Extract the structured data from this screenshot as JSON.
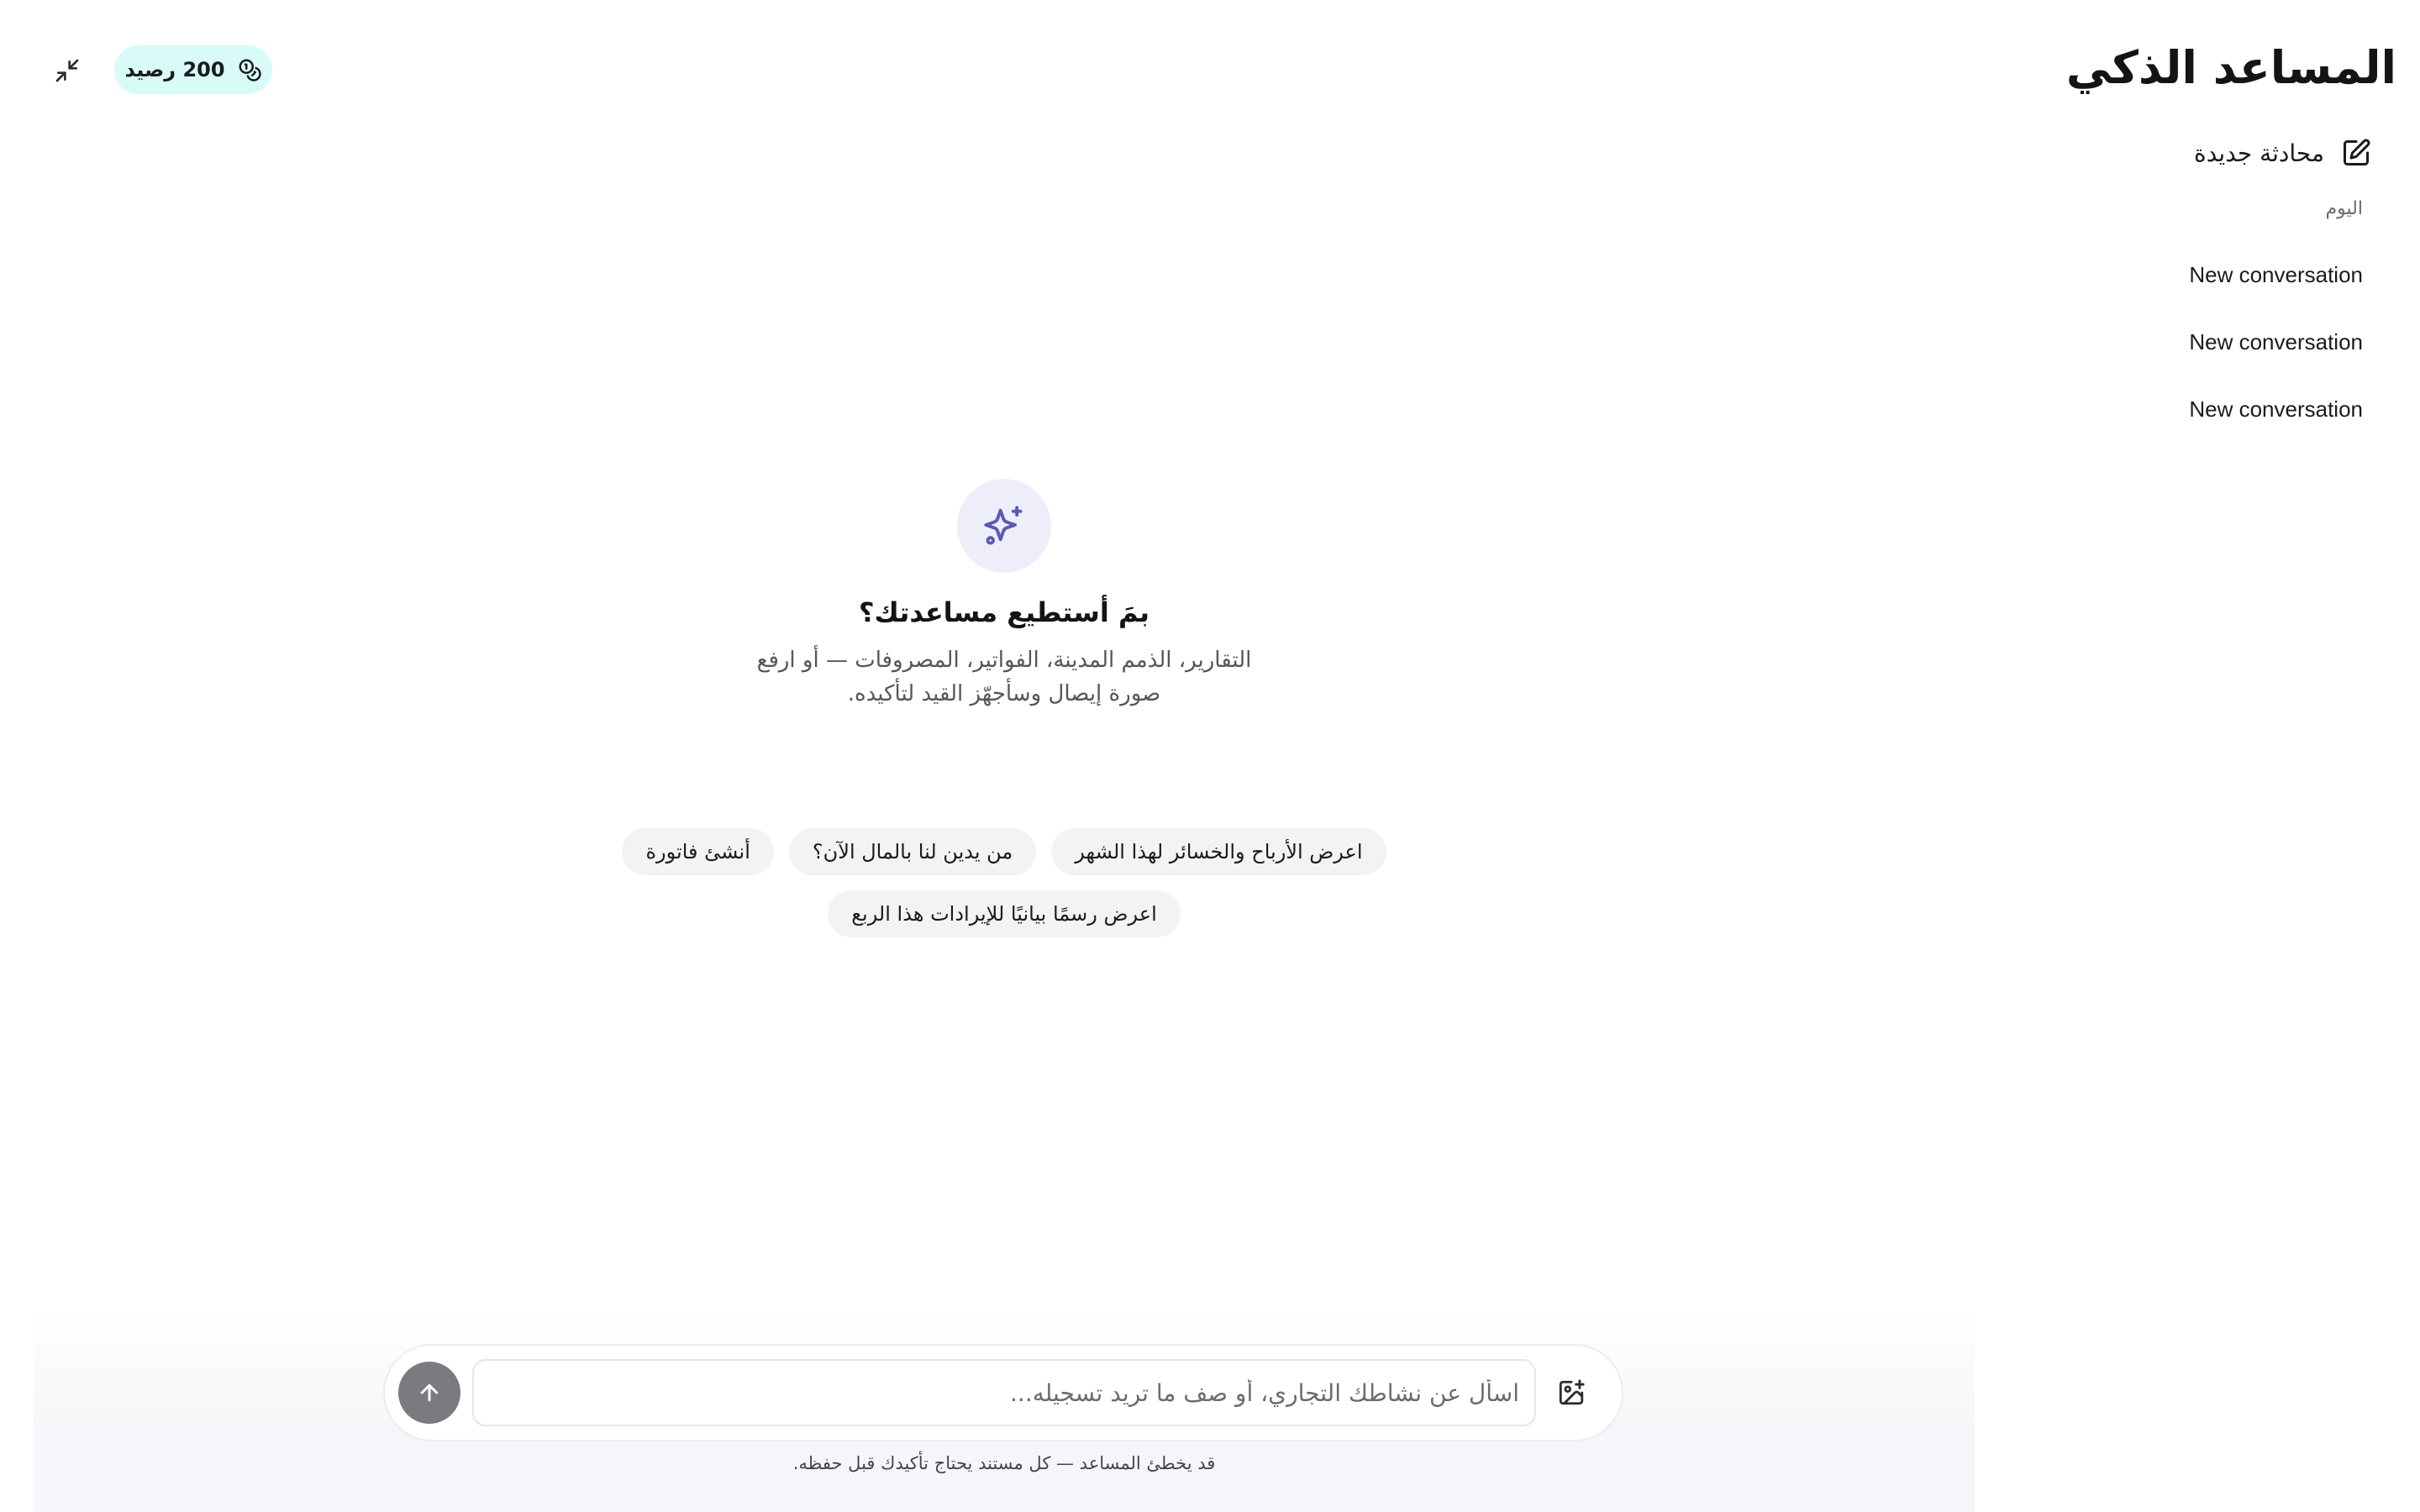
{
  "sidebar": {
    "title": "المساعد الذكي",
    "new_chat_label": "محادثة جديدة",
    "new_chat_icon": "edit-square-icon",
    "section_label": "اليوم",
    "conversations": [
      {
        "label": "New conversation"
      },
      {
        "label": "New conversation"
      },
      {
        "label": "New conversation"
      }
    ]
  },
  "header": {
    "collapse_icon": "minimize-arrows-icon",
    "credits_label": "200 رصيد",
    "credits_icon": "coins-icon",
    "credits_color": "#d9fbf8"
  },
  "welcome": {
    "icon": "sparkles-icon",
    "title": "بمَ أستطيع مساعدتك؟",
    "subtitle": "التقارير، الذمم المدينة، الفواتير، المصروفات — أو ارفع صورة إيصال وسأجهّز القيد لتأكيده."
  },
  "suggestions": {
    "row1": [
      "اعرض الأرباح والخسائر لهذا الشهر",
      "من يدين لنا بالمال الآن؟",
      "أنشئ فاتورة"
    ],
    "row2": [
      "اعرض رسمًا بيانيًا للإيرادات هذا الربع"
    ]
  },
  "composer": {
    "placeholder": "اسأل عن نشاطك التجاري، أو صف ما تريد تسجيله...",
    "value": "",
    "attach_icon": "image-plus-icon",
    "send_icon": "arrow-up-icon",
    "send_color": "#7a7a80"
  },
  "footer": {
    "disclaimer": "قد يخطئ المساعد — كل مستند يحتاج تأكيدك قبل حفظه."
  },
  "colors": {
    "accent": "#5b5bb5",
    "sparkle_bg": "#eeeefb"
  }
}
